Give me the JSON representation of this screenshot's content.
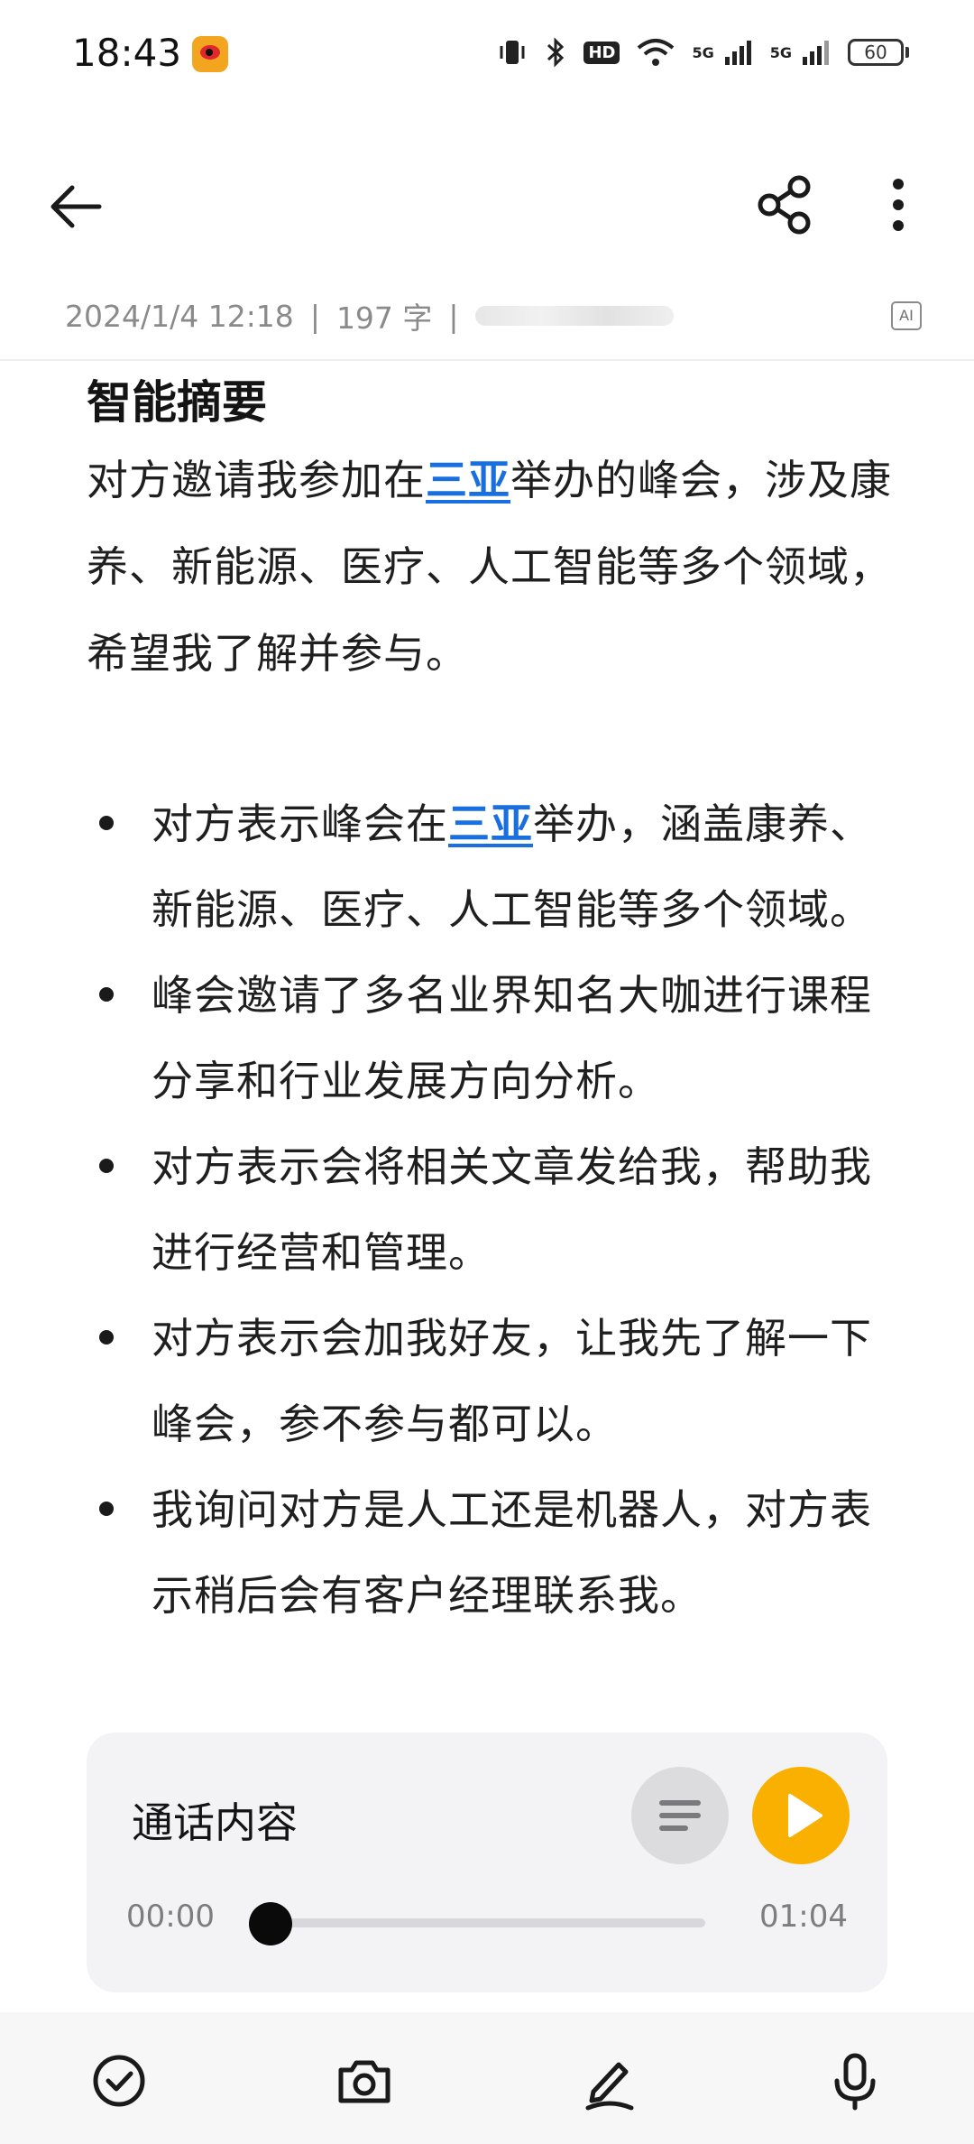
{
  "status_bar": {
    "time": "18:43",
    "notification_icon": "weibo-icon",
    "icons": [
      "vibrate-icon",
      "bluetooth-icon",
      "hd-voice-icon",
      "wifi-icon",
      "signal-5g-icon",
      "signal-5g-icon"
    ],
    "hd_label": "HD",
    "net_label_1": "5G",
    "net_label_2": "5G",
    "battery": "60"
  },
  "toolbar": {
    "back_icon": "arrow-left-icon",
    "share_icon": "share-icon",
    "more_icon": "more-vertical-icon"
  },
  "meta": {
    "datetime": "2024/1/4 12:18",
    "separator": "|",
    "word_count": "197 字",
    "ai_badge": "AI"
  },
  "summary": {
    "title": "智能摘要",
    "paragraph_before": "对方邀请我参加在",
    "paragraph_location": "三亚",
    "paragraph_after": "举办的峰会，涉及康养、新能源、医疗、人工智能等多个领域，希望我了解并参与。",
    "bullets": [
      {
        "before": "对方表示峰会在",
        "location": "三亚",
        "after": "举办，涵盖康养、新能源、医疗、人工智能等多个领域。"
      },
      {
        "text": "峰会邀请了多名业界知名大咖进行课程分享和行业发展方向分析。"
      },
      {
        "text": "对方表示会将相关文章发给我，帮助我进行经营和管理。"
      },
      {
        "text": "对方表示会加我好友，让我先了解一下峰会，参不参与都可以。"
      },
      {
        "text": "我询问对方是人工还是机器人，对方表示稍后会有客户经理联系我。"
      }
    ]
  },
  "audio": {
    "title": "通话内容",
    "current_time": "00:00",
    "duration": "01:04",
    "progress": 0,
    "accent_color": "#f9b000"
  },
  "bottom_toolbar": {
    "icons": [
      "checkbox-icon",
      "camera-icon",
      "pen-icon",
      "microphone-icon"
    ]
  }
}
